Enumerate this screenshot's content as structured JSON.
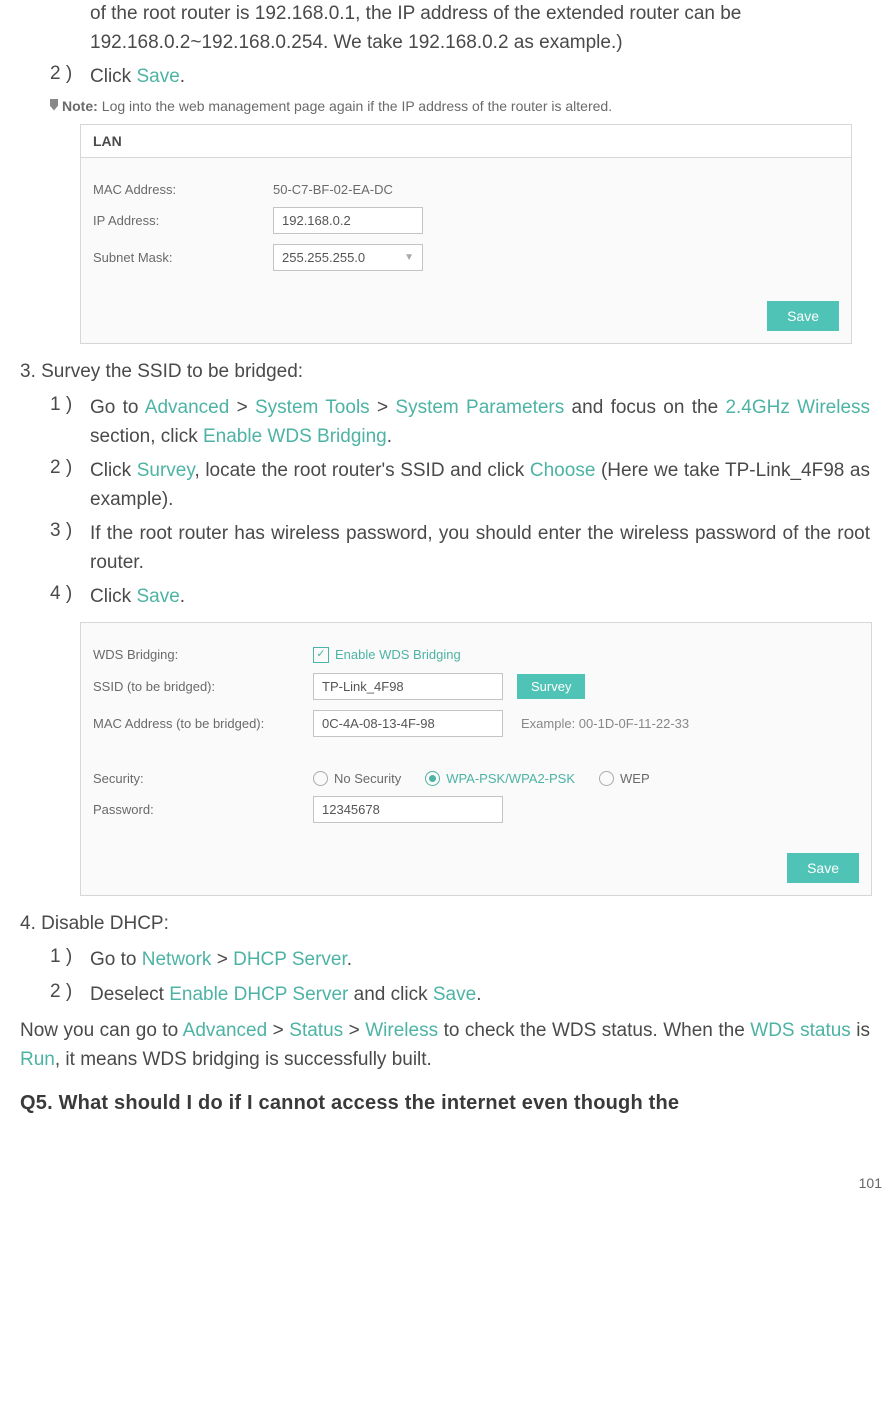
{
  "intro_cont": "of the root router is 192.168.0.1, the IP address of the extended router can be 192.168.0.2~192.168.0.254. We take 192.168.0.2 as example.)",
  "step2a": {
    "num": "2 )",
    "prefix": "Click ",
    "save": "Save",
    "suffix": "."
  },
  "note": {
    "label": "Note:",
    "text": "Log into the web management page again if the IP address of the router is altered."
  },
  "panel_lan": {
    "title": "LAN",
    "mac_label": "MAC Address:",
    "mac_value": "50-C7-BF-02-EA-DC",
    "ip_label": "IP Address:",
    "ip_value": "192.168.0.2",
    "subnet_label": "Subnet Mask:",
    "subnet_value": "255.255.255.0",
    "save": "Save"
  },
  "sec3": {
    "heading": "3. Survey the SSID to be bridged:",
    "s1": {
      "num": "1 )",
      "p1": "Go to ",
      "advanced": "Advanced",
      "sep1": " > ",
      "systools": "System Tools",
      "sep2": " > ",
      "sysparams": "System Parameters",
      "p2": " and focus on the ",
      "wl": "2.4GHz Wireless",
      "p3": " section, click ",
      "enablewds": "Enable WDS Bridging",
      "p4": "."
    },
    "s2": {
      "num": "2 )",
      "p1": "Click ",
      "survey": "Survey",
      "p2": ", locate the root router's SSID and click ",
      "choose": "Choose",
      "p3": " (Here we take TP-Link_4F98 as example)."
    },
    "s3": {
      "num": "3 )",
      "text": "If the root router has wireless password, you should enter the wireless password of the root router."
    },
    "s4": {
      "num": "4 )",
      "prefix": "Click ",
      "save": "Save",
      "suffix": "."
    }
  },
  "panel_wds": {
    "wds_label": "WDS Bridging:",
    "enable_label": "Enable WDS Bridging",
    "ssid_label": "SSID (to be bridged):",
    "ssid_value": "TP-Link_4F98",
    "survey_btn": "Survey",
    "mac_label": "MAC Address (to be bridged):",
    "mac_value": "0C-4A-08-13-4F-98",
    "example": "Example: 00-1D-0F-11-22-33",
    "security_label": "Security:",
    "opt_nosec": "No Security",
    "opt_wpa": "WPA-PSK/WPA2-PSK",
    "opt_wep": "WEP",
    "pwd_label": "Password:",
    "pwd_value": "12345678",
    "save": "Save"
  },
  "sec4": {
    "heading": "4. Disable DHCP:",
    "s1": {
      "num": "1 )",
      "p1": "Go to ",
      "network": "Network",
      "sep": " > ",
      "dhcp": "DHCP Server",
      "p2": "."
    },
    "s2": {
      "num": "2 )",
      "p1": "Deselect ",
      "enable_dhcp": "Enable DHCP Server",
      "p2": " and click ",
      "save": "Save",
      "p3": "."
    }
  },
  "closing": {
    "p1": "Now you can go to ",
    "advanced": "Advanced",
    "sep1": " > ",
    "status": "Status",
    "sep2": " > ",
    "wireless": "Wireless",
    "p2": " to check the WDS status. When the ",
    "wds_status": "WDS status",
    "p3": " is ",
    "run": "Run",
    "p4": ", it means WDS bridging is successfully built."
  },
  "q5": "Q5. What should I do if I cannot access the internet even though the",
  "page_number": "101"
}
